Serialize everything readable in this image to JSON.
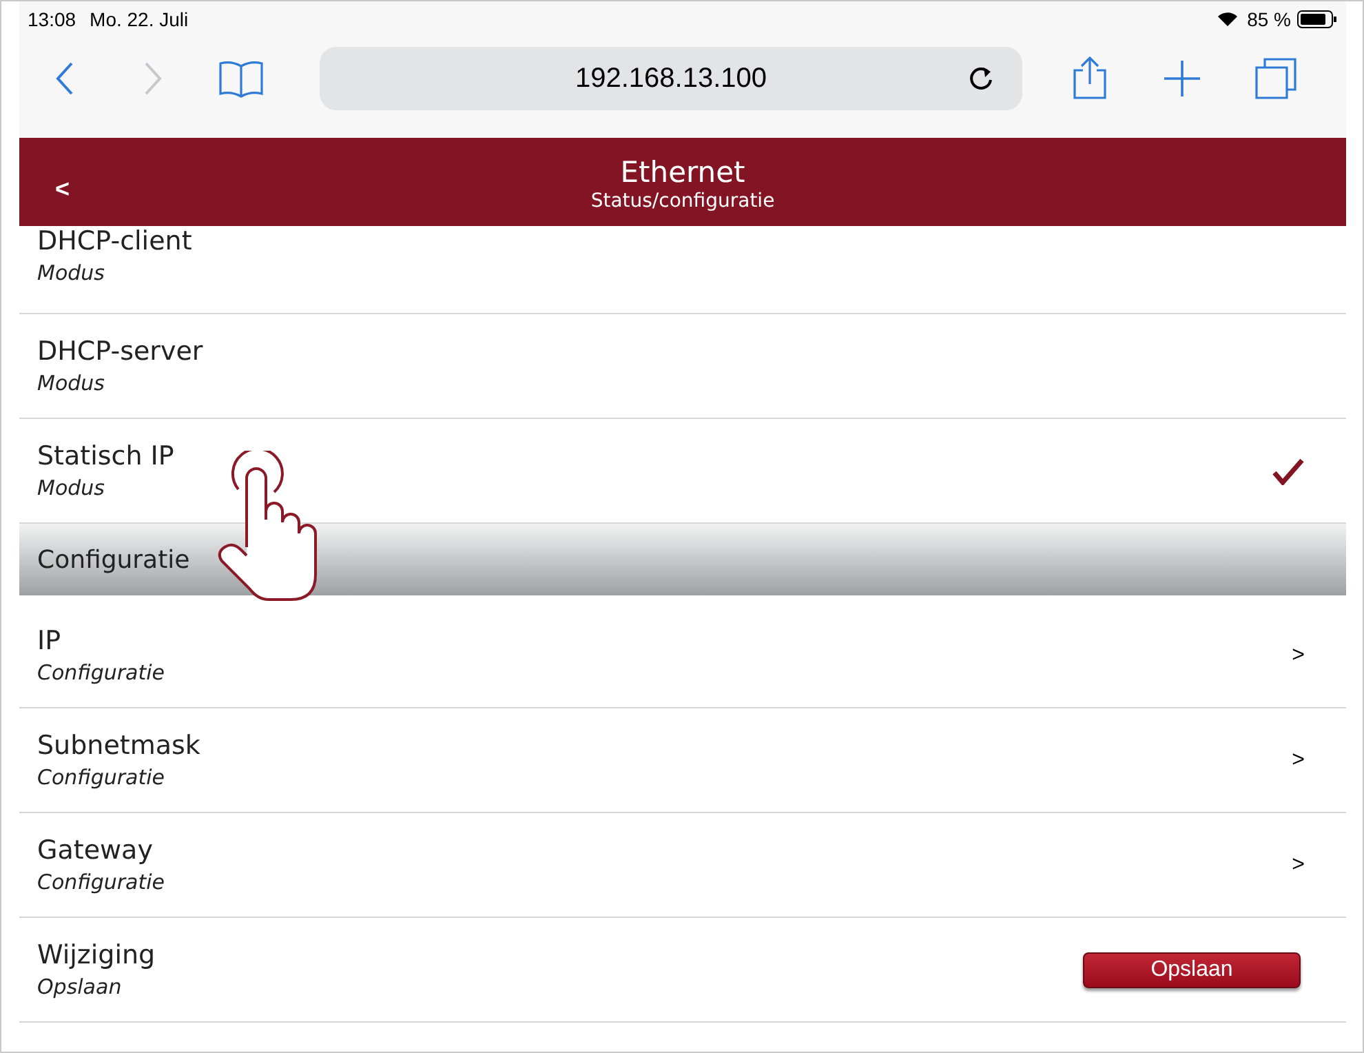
{
  "status_bar": {
    "time": "13:08",
    "date": "Mo. 22. Juli",
    "battery": "85 %"
  },
  "browser": {
    "address": "192.168.13.100"
  },
  "header": {
    "back": "<",
    "title": "Ethernet",
    "subtitle": "Status/configuratie"
  },
  "modes": [
    {
      "title": "DHCP-client",
      "subtitle": "Modus",
      "selected": false
    },
    {
      "title": "DHCP-server",
      "subtitle": "Modus",
      "selected": false
    },
    {
      "title": "Statisch IP",
      "subtitle": "Modus",
      "selected": true
    }
  ],
  "section": {
    "title": "Configuratie"
  },
  "config_rows": [
    {
      "kind": "link",
      "title": "IP",
      "subtitle": "Configuratie",
      "action": ">"
    },
    {
      "kind": "link",
      "title": "Subnetmask",
      "subtitle": "Configuratie",
      "action": ">"
    },
    {
      "kind": "link",
      "title": "Gateway",
      "subtitle": "Configuratie",
      "action": ">"
    },
    {
      "kind": "button",
      "title": "Wijziging",
      "subtitle": "Opslaan",
      "action": "Opslaan"
    }
  ]
}
